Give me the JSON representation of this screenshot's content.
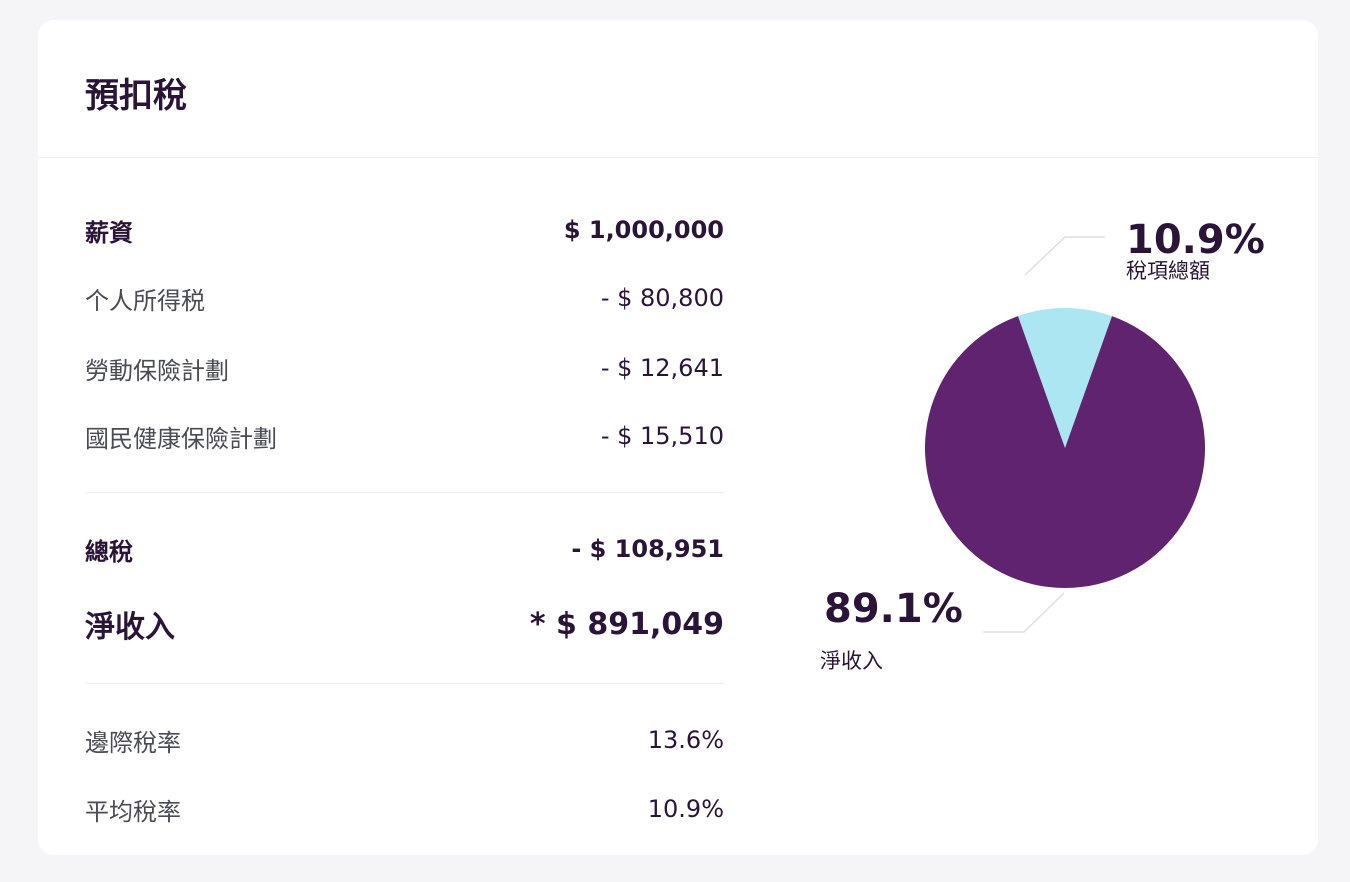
{
  "title": "預扣稅",
  "rows": [
    {
      "label": "薪資",
      "value": "$ 1,000,000"
    },
    {
      "label": "个人所得税",
      "value": "- $ 80,800"
    },
    {
      "label": "勞動保險計劃",
      "value": "- $ 12,641"
    },
    {
      "label": "國民健康保險計劃",
      "value": "- $ 15,510"
    }
  ],
  "total_tax": {
    "label": "總稅",
    "value": "- $ 108,951"
  },
  "net_income": {
    "label": "淨收入",
    "value": "* $ 891,049"
  },
  "rates": [
    {
      "label": "邊際稅率",
      "value": "13.6%"
    },
    {
      "label": "平均稅率",
      "value": "10.9%"
    }
  ],
  "colors": {
    "tax_slice": "#abe6f2",
    "net_slice": "#5f2370",
    "text_dark": "#2a1538"
  },
  "chart_data": {
    "type": "pie",
    "slices": [
      {
        "name": "稅項總額",
        "value": 10.9,
        "label": "10.9%",
        "color": "#abe6f2"
      },
      {
        "name": "淨收入",
        "value": 89.1,
        "label": "89.1%",
        "color": "#5f2370"
      }
    ]
  }
}
